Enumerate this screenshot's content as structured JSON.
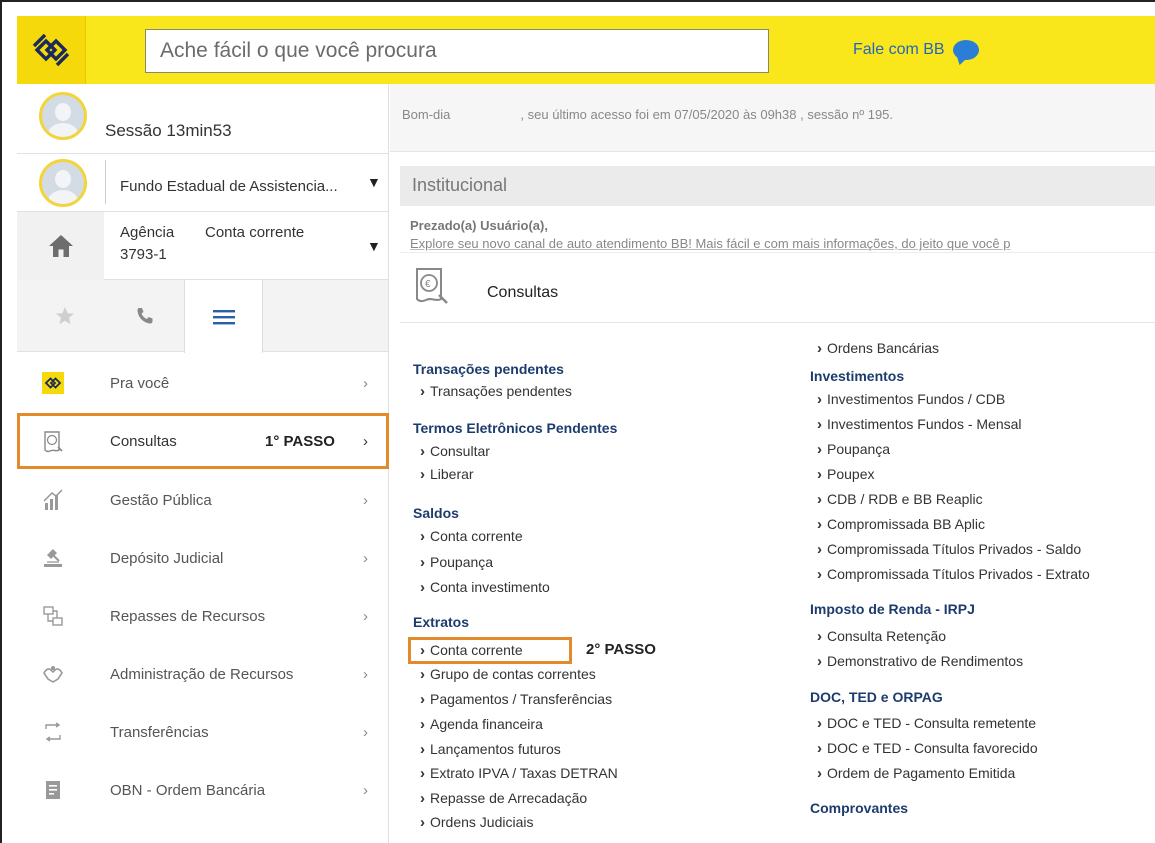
{
  "header": {
    "search_placeholder": "Ache fácil o que você procura",
    "contact_label": "Fale com BB"
  },
  "sidebar": {
    "session": "Sessão 13min53",
    "account_name": "Fundo Estadual de Assistencia...",
    "agency_label": "Agência",
    "agency_number": "3793-1",
    "account_type": "Conta corrente",
    "menu": [
      {
        "label": "Pra você",
        "icon": "bb-logo-icon"
      },
      {
        "label": "Consultas",
        "icon": "receipt-icon",
        "note": "1° PASSO"
      },
      {
        "label": "Gestão Pública",
        "icon": "chart-icon"
      },
      {
        "label": "Depósito Judicial",
        "icon": "gavel-icon"
      },
      {
        "label": "Repasses de Recursos",
        "icon": "transfer-funds-icon"
      },
      {
        "label": "Administração de Recursos",
        "icon": "hands-icon"
      },
      {
        "label": "Transferências",
        "icon": "transfer-icon"
      },
      {
        "label": "OBN - Ordem Bancária",
        "icon": "document-icon"
      }
    ]
  },
  "main": {
    "greeting": "Bom-dia",
    "last_access": ", seu último acesso foi em 07/05/2020 às 09h38 , sessão nº 195.",
    "section_title": "Institucional",
    "prezado": "Prezado(a) Usuário(a),",
    "explore": "Explore seu novo canal de auto atendimento BB! Mais fácil e com mais informações, do jeito que você p",
    "panel_title": "Consultas"
  },
  "consultas": {
    "col1": [
      {
        "type": "h",
        "text": "Transações pendentes"
      },
      {
        "type": "i",
        "text": "Transações pendentes"
      },
      {
        "type": "h",
        "text": "Termos Eletrônicos Pendentes"
      },
      {
        "type": "i",
        "text": "Consultar"
      },
      {
        "type": "i",
        "text": "Liberar"
      },
      {
        "type": "h",
        "text": "Saldos"
      },
      {
        "type": "i",
        "text": "Conta corrente"
      },
      {
        "type": "i",
        "text": "Poupança"
      },
      {
        "type": "i",
        "text": "Conta investimento"
      },
      {
        "type": "h",
        "text": "Extratos"
      },
      {
        "type": "i",
        "text": "Conta corrente",
        "note": "2° PASSO"
      },
      {
        "type": "i",
        "text": "Grupo de contas correntes"
      },
      {
        "type": "i",
        "text": "Pagamentos / Transferências"
      },
      {
        "type": "i",
        "text": "Agenda financeira"
      },
      {
        "type": "i",
        "text": "Lançamentos futuros"
      },
      {
        "type": "i",
        "text": "Extrato IPVA / Taxas DETRAN"
      },
      {
        "type": "i",
        "text": "Repasse de Arrecadação"
      },
      {
        "type": "i",
        "text": "Ordens Judiciais"
      }
    ],
    "col2": [
      {
        "type": "i",
        "text": "Ordens Bancárias"
      },
      {
        "type": "h",
        "text": "Investimentos"
      },
      {
        "type": "i",
        "text": "Investimentos Fundos / CDB"
      },
      {
        "type": "i",
        "text": "Investimentos Fundos - Mensal"
      },
      {
        "type": "i",
        "text": "Poupança"
      },
      {
        "type": "i",
        "text": "Poupex"
      },
      {
        "type": "i",
        "text": "CDB / RDB e BB Reaplic"
      },
      {
        "type": "i",
        "text": "Compromissada BB Aplic"
      },
      {
        "type": "i",
        "text": "Compromissada Títulos Privados - Saldo"
      },
      {
        "type": "i",
        "text": "Compromissada Títulos Privados - Extrato"
      },
      {
        "type": "h",
        "text": "Imposto de Renda - IRPJ"
      },
      {
        "type": "i",
        "text": "Consulta Retenção"
      },
      {
        "type": "i",
        "text": "Demonstrativo de Rendimentos"
      },
      {
        "type": "h",
        "text": "DOC, TED e ORPAG"
      },
      {
        "type": "i",
        "text": "DOC e TED - Consulta remetente"
      },
      {
        "type": "i",
        "text": "DOC e TED - Consulta favorecido"
      },
      {
        "type": "i",
        "text": "Ordem de Pagamento Emitida"
      },
      {
        "type": "h",
        "text": "Comprovantes"
      }
    ]
  },
  "colors": {
    "brand_yellow": "#f9e71c",
    "brand_blue": "#1d3c6e",
    "highlight_orange": "#e38b2c",
    "chat_blue": "#2a7ed6"
  }
}
